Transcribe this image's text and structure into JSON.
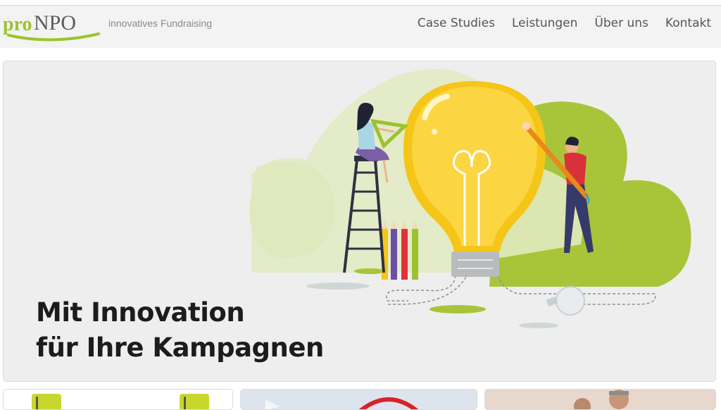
{
  "brand": {
    "logo_pro": "pro",
    "logo_npo": "NPO",
    "tagline": "innovatives Fundraising",
    "accent_green": "#9dc22d",
    "logo_grey": "#5b5b5b"
  },
  "nav": {
    "items": [
      {
        "label": "Case Studies"
      },
      {
        "label": "Leistungen"
      },
      {
        "label": "Über uns"
      },
      {
        "label": "Kontakt"
      }
    ]
  },
  "hero": {
    "title_line1": "Mit Innovation",
    "title_line2": "für Ihre Kampagnen",
    "illustration": "lightbulb-idea-illustration"
  },
  "cards": [
    {
      "image": "green-objects-thumbnail"
    },
    {
      "image": "red-circle-thumbnail"
    },
    {
      "image": "people-thumbnail"
    }
  ]
}
